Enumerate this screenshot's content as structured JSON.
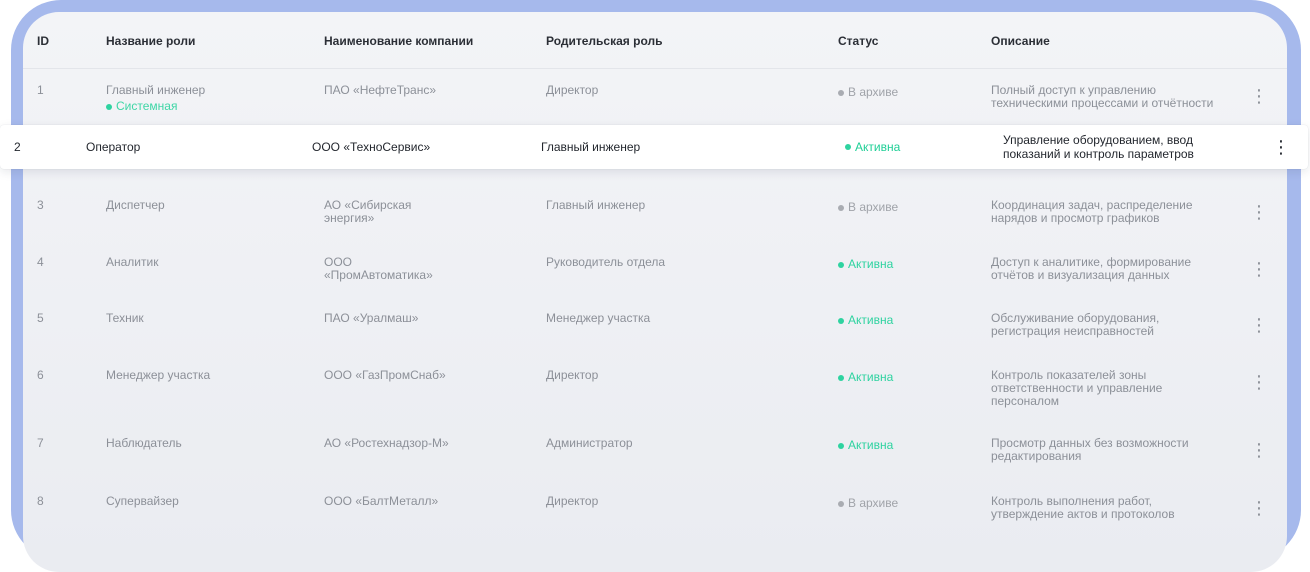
{
  "columns": {
    "id": "ID",
    "name": "Название роли",
    "company": "Наименование компании",
    "parent": "Родительская роль",
    "status": "Статус",
    "description": "Описание"
  },
  "status_labels": {
    "active": "Активна",
    "archived": "В архиве"
  },
  "system_badge": "Системная",
  "colors": {
    "frame": "#a6b9ec",
    "active": "#2ed3a0",
    "archived": "#a9acb2"
  },
  "icons": {
    "row_menu": "kebab-vertical-icon"
  },
  "rows": [
    {
      "id": "1",
      "name": "Главный инженер",
      "system": true,
      "company": "ПАО «НефтеТранс»",
      "parent": "Директор",
      "status": "archived",
      "status_text": "В архиве",
      "description": "Полный доступ к управлению техническими процессами и отчётности"
    },
    {
      "id": "2",
      "name": "Оператор",
      "company": "ООО «ТехноСервис»",
      "parent": "Главный инженер",
      "status": "active",
      "status_text": "Активна",
      "description": "Управление оборудованием, ввод показаний и контроль параметров",
      "highlighted": true
    },
    {
      "id": "3",
      "name": "Диспетчер",
      "company": "АО «Сибирская энергия»",
      "parent": "Главный инженер",
      "status": "archived",
      "status_text": "В архиве",
      "description": "Координация задач, распределение нарядов и просмотр графиков"
    },
    {
      "id": "4",
      "name": "Аналитик",
      "company": "ООО «ПромАвтоматика»",
      "parent": "Руководитель отдела",
      "status": "active",
      "status_text": "Активна",
      "description": "Доступ к аналитике, формирование отчётов и визуализация данных"
    },
    {
      "id": "5",
      "name": "Техник",
      "company": "ПАО «Уралмаш»",
      "parent": "Менеджер участка",
      "status": "active",
      "status_text": "Активна",
      "description": "Обслуживание оборудования, регистрация неисправностей"
    },
    {
      "id": "6",
      "name": "Менеджер участка",
      "company": "ООО «ГазПромСнаб»",
      "parent": "Директор",
      "status": "active",
      "status_text": "Активна",
      "description": "Контроль показателей зоны ответственности и управление персоналом"
    },
    {
      "id": "7",
      "name": "Наблюдатель",
      "company": "АО «Ростехнадзор-М»",
      "parent": "Администратор",
      "status": "active",
      "status_text": "Активна",
      "description": "Просмотр данных без возможности редактирования"
    },
    {
      "id": "8",
      "name": "Супервайзер",
      "company": "ООО «БалтМеталл»",
      "parent": "Директор",
      "status": "archived",
      "status_text": "В архиве",
      "description": "Контроль выполнения работ, утверждение актов и протоколов"
    }
  ]
}
